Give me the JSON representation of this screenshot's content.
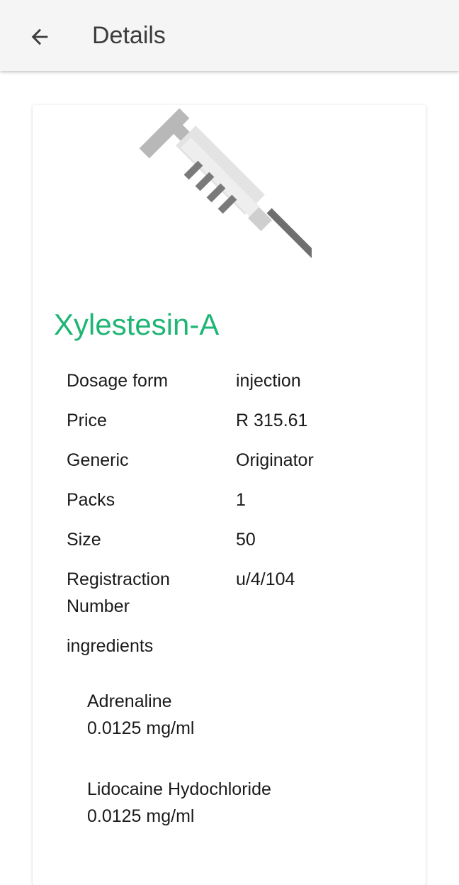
{
  "app_bar": {
    "title": "Details",
    "back_icon": "arrow-back-icon"
  },
  "product": {
    "image_icon": "syringe-icon",
    "name": "Xylestesin-A",
    "name_color": "#1fb574",
    "details": [
      {
        "label": "Dosage form",
        "value": "injection"
      },
      {
        "label": "Price",
        "value": "R 315.61"
      },
      {
        "label": "Generic",
        "value": "Originator"
      },
      {
        "label": "Packs",
        "value": "1"
      },
      {
        "label": "Size",
        "value": "50"
      },
      {
        "label": "Registraction Number",
        "value": "u/4/104"
      }
    ],
    "ingredients_heading": "ingredients",
    "ingredients": [
      {
        "name": "Adrenaline",
        "strength": "0.0125 mg/ml"
      },
      {
        "name": "Lidocaine Hydochloride",
        "strength": "0.0125 mg/ml"
      }
    ]
  }
}
